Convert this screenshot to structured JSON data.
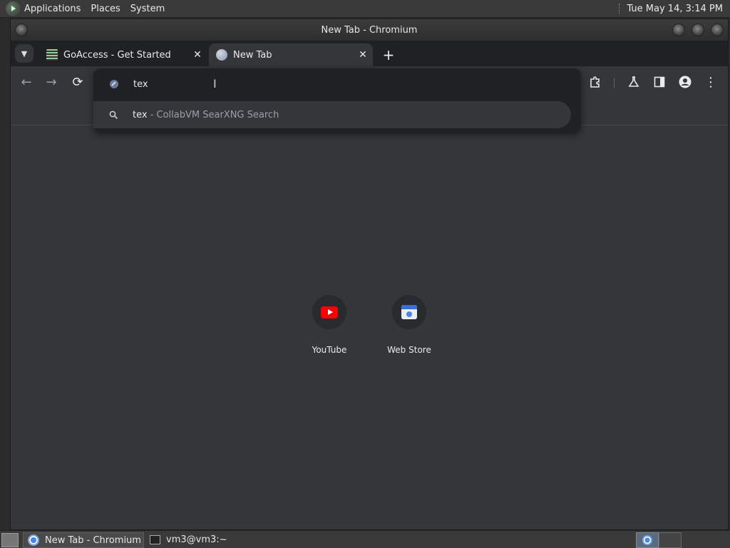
{
  "top_panel": {
    "menus": [
      "Applications",
      "Places",
      "System"
    ],
    "clock": "Tue May 14,  3:14 PM"
  },
  "window": {
    "title": "New Tab - Chromium"
  },
  "tabs": [
    {
      "title": "GoAccess - Get Started",
      "close": "✕"
    },
    {
      "title": "New Tab",
      "close": "✕"
    }
  ],
  "new_tab_symbol": "+",
  "toolbar": {
    "back_icon": "←",
    "forward_icon": "→",
    "reload_icon": "⟳",
    "extensions_icon": "puzzle-icon",
    "labs_icon": "flask-icon",
    "sidepanel_icon": "side-panel-icon",
    "profile_icon": "person-icon",
    "menu_icon": "⋮"
  },
  "omnibox": {
    "value": "tex",
    "suggestion": {
      "query": "tex",
      "separator": " - ",
      "provider": "CollabVM SearXNG Search"
    }
  },
  "shortcuts": [
    {
      "label": "YouTube",
      "icon": "youtube-icon"
    },
    {
      "label": "Web Store",
      "icon": "web-store-icon"
    }
  ],
  "taskbar": {
    "items": [
      {
        "label": "New Tab - Chromium"
      },
      {
        "label": "vm3@vm3:~"
      }
    ]
  },
  "colors": {
    "accent": "#8ab4f8",
    "page_bg": "#35363a",
    "tabstrip_bg": "#202124",
    "youtube_red": "#ff0000"
  }
}
